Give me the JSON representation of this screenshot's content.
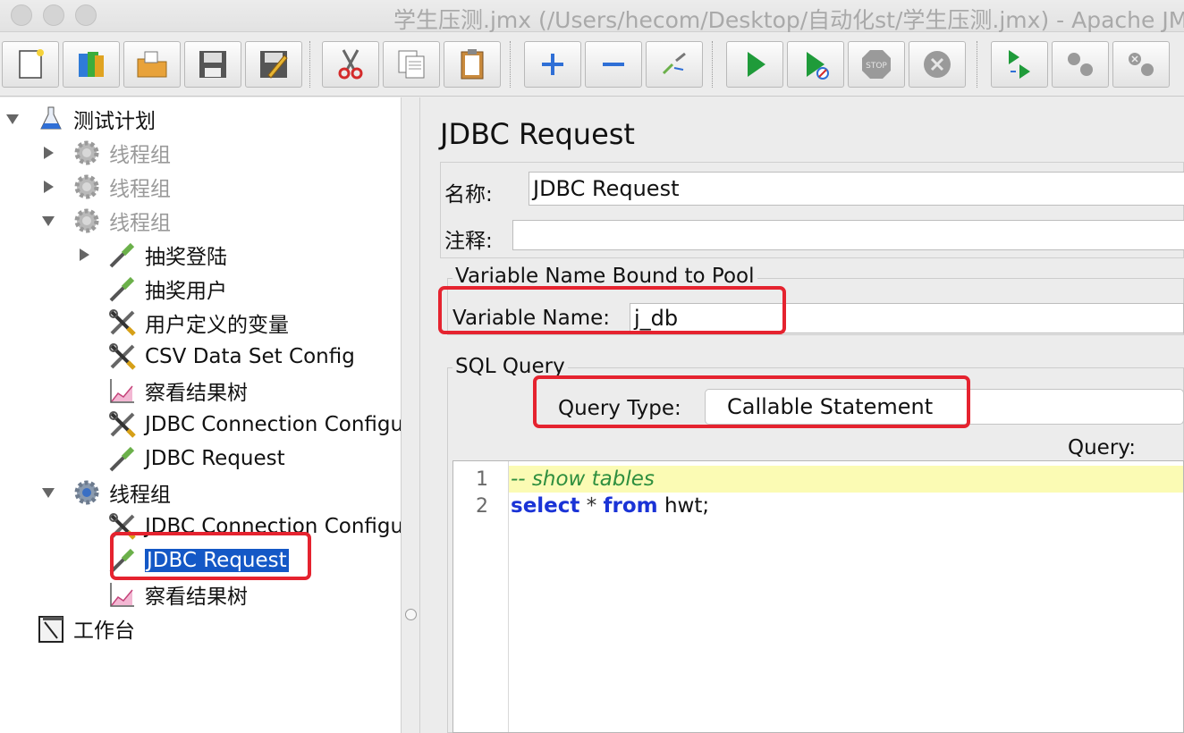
{
  "window": {
    "title": "学生压测.jmx (/Users/hecom/Desktop/自动化st/学生压测.jmx) - Apache JM"
  },
  "toolbar": {
    "buttons": [
      {
        "name": "new-icon"
      },
      {
        "name": "templates-icon"
      },
      {
        "name": "open-icon"
      },
      {
        "name": "save-icon"
      },
      {
        "name": "save-as-icon"
      },
      {
        "name": "cut-icon"
      },
      {
        "name": "copy-icon"
      },
      {
        "name": "paste-icon"
      },
      {
        "name": "expand-icon"
      },
      {
        "name": "collapse-icon"
      },
      {
        "name": "toggle-icon"
      },
      {
        "name": "start-icon"
      },
      {
        "name": "start-no-pause-icon"
      },
      {
        "name": "stop-icon"
      },
      {
        "name": "shutdown-icon"
      },
      {
        "name": "remote-start-icon"
      },
      {
        "name": "remote-stop-icon"
      },
      {
        "name": "remote-shutdown-icon"
      }
    ]
  },
  "tree": {
    "items": [
      {
        "label": "测试计划",
        "icon": "test-plan-icon"
      },
      {
        "label": "线程组",
        "icon": "gear-icon",
        "disabled": true
      },
      {
        "label": "线程组",
        "icon": "gear-icon",
        "disabled": true
      },
      {
        "label": "线程组",
        "icon": "gear-icon",
        "disabled": true
      },
      {
        "label": "抽奖登陆",
        "icon": "pipette-icon"
      },
      {
        "label": "抽奖用户",
        "icon": "pipette-icon"
      },
      {
        "label": "用户定义的变量",
        "icon": "wrench-icon"
      },
      {
        "label": "CSV Data Set Config",
        "icon": "wrench-icon"
      },
      {
        "label": "察看结果树",
        "icon": "graph-icon"
      },
      {
        "label": "JDBC Connection Configu",
        "icon": "wrench-icon"
      },
      {
        "label": "JDBC Request",
        "icon": "pipette-icon"
      },
      {
        "label": "线程组",
        "icon": "gear-icon"
      },
      {
        "label": "JDBC Connection Configu",
        "icon": "wrench-icon"
      },
      {
        "label": "JDBC Request",
        "icon": "pipette-icon",
        "selected": true
      },
      {
        "label": "察看结果树",
        "icon": "graph-icon"
      },
      {
        "label": "工作台",
        "icon": "workbench-icon"
      }
    ]
  },
  "panel": {
    "title": "JDBC Request",
    "name_label": "名称:",
    "name_value": "JDBC Request",
    "comment_label": "注释:",
    "comment_value": "",
    "pool_group_title": "Variable Name Bound to Pool",
    "variable_label": "Variable Name:",
    "variable_value": "j_db",
    "sql_group_title": "SQL Query",
    "query_type_label": "Query Type:",
    "query_type_value": "Callable Statement",
    "query_label": "Query:",
    "code": {
      "line1_no": "1",
      "line1_text": "-- show tables",
      "line2_no": "2",
      "line2_kw1": "select",
      "line2_star": " * ",
      "line2_kw2": "from",
      "line2_rest": " hwt;"
    }
  },
  "colors": {
    "annotation": "#e5232f",
    "selection": "#1458c6",
    "highlight_line": "#fbfbb4"
  }
}
